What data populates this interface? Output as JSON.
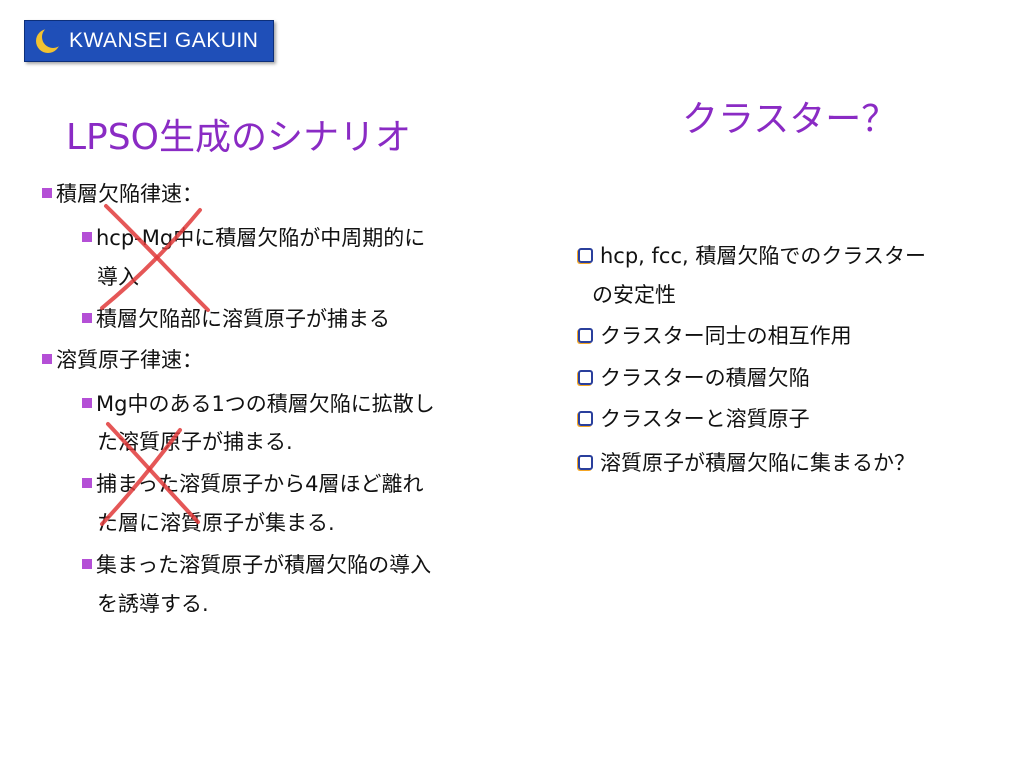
{
  "logo": {
    "text": "KWANSEI GAKUIN",
    "icon": "crescent-moon-icon"
  },
  "left": {
    "title": "LPSO生成のシナリオ",
    "lines": [
      "積層欠陥律速：",
      "hcp-Mg中に積層欠陥が中周期的に",
      "導入",
      "積層欠陥部に溶質原子が捕まる",
      "溶質原子律速：",
      "Mg中のある1つの積層欠陥に拡散し",
      "た溶質原子が捕まる.",
      "捕まった溶質原子から4層ほど離れ",
      "た層に溶質原子が集まる.",
      "集まった溶質原子が積層欠陥の導入",
      "を誘導する."
    ]
  },
  "right": {
    "title": "クラスター？",
    "lines": [
      "hcp, fcc, 積層欠陥でのクラスター",
      "の安定性",
      "クラスター同士の相互作用",
      "クラスターの積層欠陥",
      "クラスターと溶質原子",
      "溶質原子が積層欠陥に集まるか？"
    ]
  },
  "colors": {
    "title": "#8a2bc4",
    "bullet": "#b44fd6",
    "checkbox": "#2a3f9c",
    "cross": "#e03a3a",
    "logo_bg": "#1f4fb8"
  }
}
